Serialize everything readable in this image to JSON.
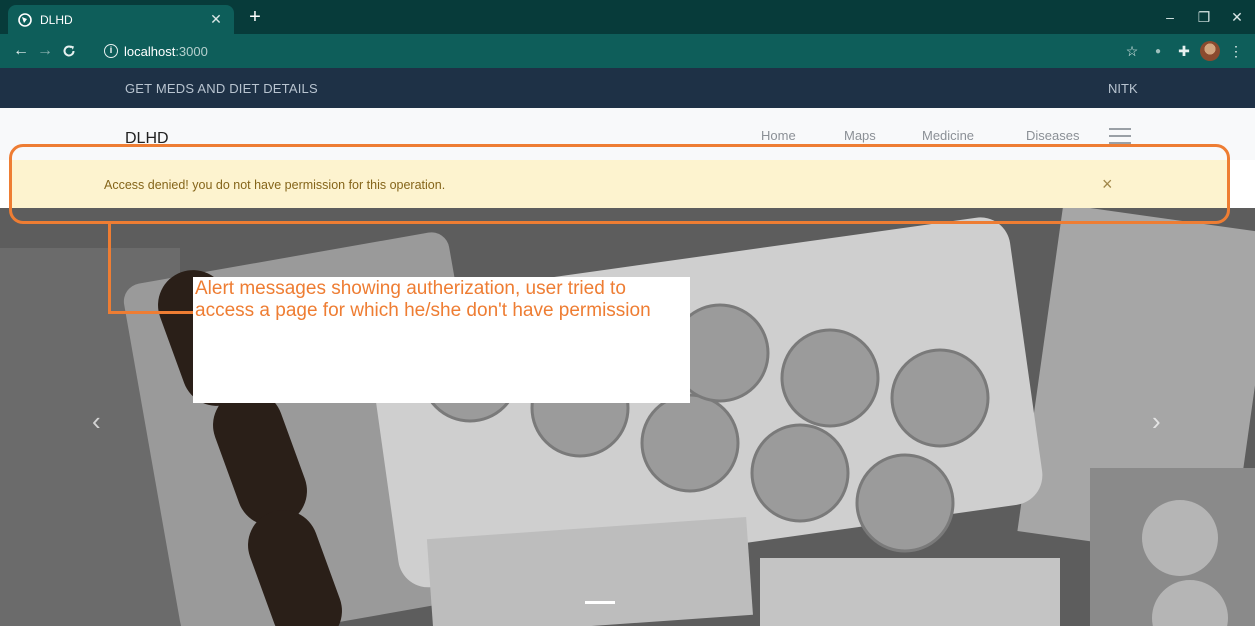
{
  "browser": {
    "tab_title": "DLHD",
    "url_host": "localhost",
    "url_port": ":3000"
  },
  "topbar": {
    "left_text": "GET MEDS AND DIET DETAILS",
    "right_text": "NITK"
  },
  "navbar": {
    "brand": "DLHD",
    "links": [
      "Home",
      "Maps",
      "Medicine",
      "Diseases"
    ]
  },
  "alert": {
    "message": "Access denied! you do not have permission for this operation.",
    "close_glyph": "×"
  },
  "annotation": {
    "note": "Alert messages showing autherization, user tried to access a page for which he/she don't have permission",
    "color": "#ee7d33"
  },
  "colors": {
    "chrome_dark": "#073b3a",
    "chrome_toolbar": "#0e5e5a",
    "topbar": "#1e3146",
    "alert_bg": "#fdf3cf",
    "alert_text": "#85651a"
  },
  "icons": [
    "globe-icon",
    "close-icon",
    "plus-icon",
    "back-icon",
    "forward-icon",
    "reload-icon",
    "info-icon",
    "star-icon",
    "extension-icon",
    "puzzle-icon",
    "menu-icon",
    "chevron-left-icon",
    "chevron-right-icon"
  ]
}
